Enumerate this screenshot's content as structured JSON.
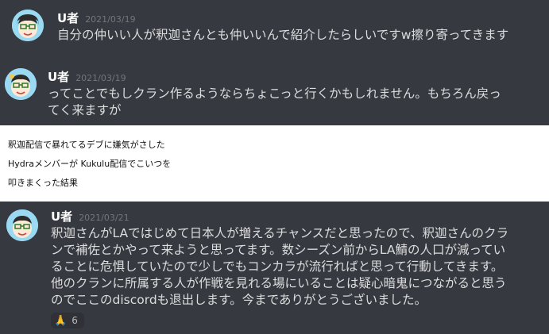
{
  "messages": [
    {
      "username": "U者",
      "timestamp": "2021/03/19",
      "text": "自分の仲いい人が釈迦さんとも仲いいんで紹介したらしいですw擦り寄ってきます"
    },
    {
      "username": "U者",
      "timestamp": "2021/03/19",
      "text": "ってことでもしクラン作るようならちょこっと行くかもしれません。もちろん戻っ\nてく来ますが"
    },
    {
      "username": "U者",
      "timestamp": "2021/03/21",
      "text": "釈迦さんがLAではじめて日本人が増えるチャンスだと思ったので、釈迦さんのクラ\nンで補佐とかやって来ようと思ってます。数シーズン前からLA鯖の人口が減ってい\nることに危惧していたので少しでもコンカラが流行ればと思って行動してきます。\n他のクランに所属する人が作戦を見れる場にいることは疑心暗鬼につながると思う\nのでここのdiscordも退出します。今までありがとうございました。",
      "reaction": {
        "emoji": "🙏",
        "icon": "folded-hands-icon",
        "count": "6"
      }
    }
  ],
  "note": {
    "lines": [
      "釈迦配信で暴れてるデブに嫌気がさした",
      "Hydraメンバーが Kukulu配信でこいつを",
      "叩きまくった結果"
    ]
  },
  "colors": {
    "background": "#36393f",
    "username": "#ffffff",
    "timestamp": "#72767d",
    "message_text": "#dcddde",
    "note_background": "#ffffff"
  }
}
